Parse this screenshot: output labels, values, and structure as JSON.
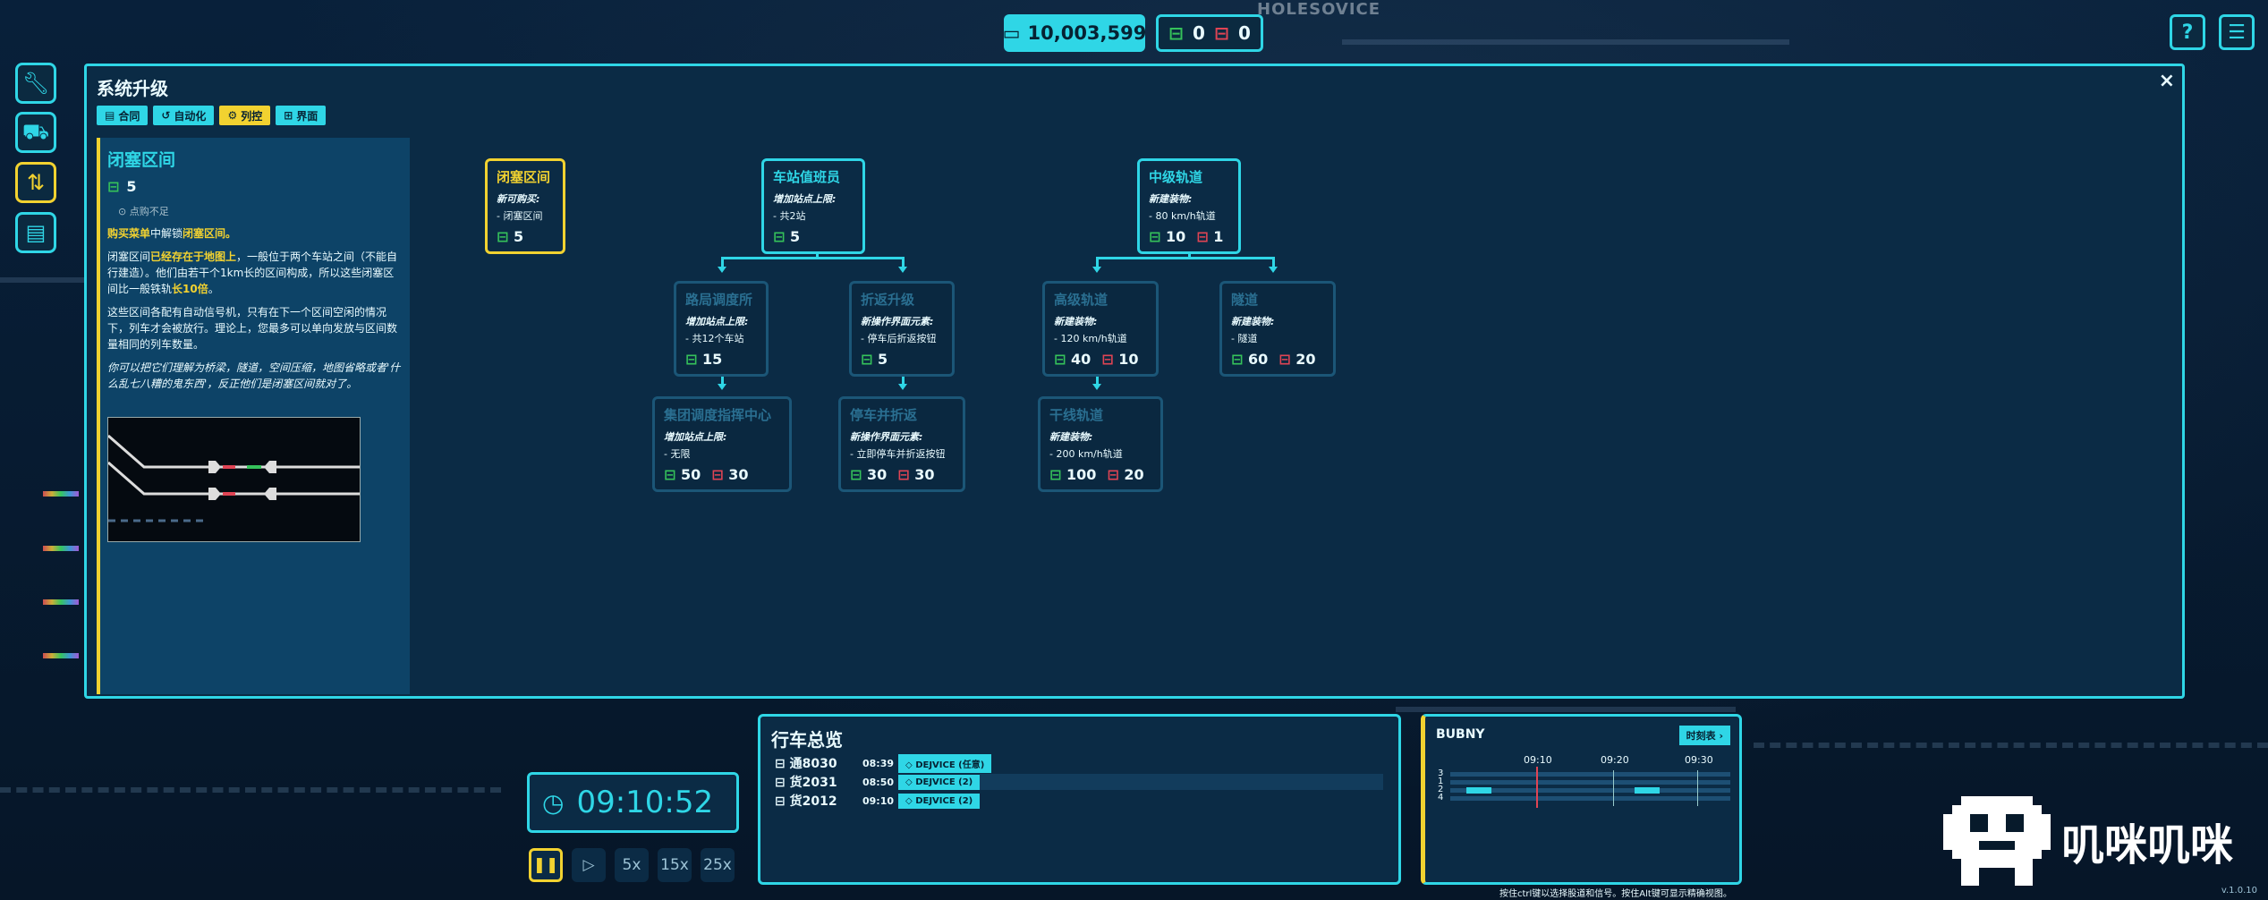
{
  "map": {
    "district_label": "HOLESOVICE"
  },
  "topbar": {
    "money": "10,003,599",
    "trains_green": "0",
    "trains_red": "0",
    "help_label": "?"
  },
  "panel": {
    "title": "系统升级",
    "close_label": "×",
    "tabs": [
      {
        "label": "合同"
      },
      {
        "label": "自动化"
      },
      {
        "label": "列控"
      },
      {
        "label": "界面"
      }
    ],
    "detail": {
      "title": "闭塞区间",
      "cost": "5",
      "status": "⊙ 点购不足",
      "p1_a": "购买菜单",
      "p1_b": "中解锁",
      "p1_c": "闭塞区间。",
      "p2_a": "闭塞区间",
      "p2_b": "已经存在于地图上",
      "p2_c": "，一般位于两个车站之间（不能自行建造）。他们由若干个1km长的区间构成，所以这些闭塞区间比一般铁轨",
      "p2_d": "长10倍",
      "p2_e": "。",
      "p3": "这些区间各配有自动信号机，只有在下一个区间空闲的情况下，列车才会被放行。理论上，您最多可以单向发放与区间数量相同的列车数量。",
      "p4": "你可以把它们理解为桥梁，隧道，空间压缩，地图省略或者'什么乱七八糟的鬼东西'，反正他们是闭塞区间就对了。"
    },
    "nodes": [
      {
        "title": "闭塞区间",
        "sub": "新可购买:",
        "line": "- 闭塞区间",
        "g": "5",
        "r": ""
      },
      {
        "title": "车站值班员",
        "sub": "增加站点上限:",
        "line": "- 共2站",
        "g": "5",
        "r": ""
      },
      {
        "title": "中级轨道",
        "sub": "新建装物:",
        "line": "- 80 km/h轨道",
        "g": "10",
        "r": "1"
      },
      {
        "title": "路局调度所",
        "sub": "增加站点上限:",
        "line": "- 共12个车站",
        "g": "15",
        "r": ""
      },
      {
        "title": "折返升级",
        "sub": "新操作界面元素:",
        "line": "- 停车后折返按钮",
        "g": "5",
        "r": ""
      },
      {
        "title": "高级轨道",
        "sub": "新建装物:",
        "line": "- 120 km/h轨道",
        "g": "40",
        "r": "10"
      },
      {
        "title": "隧道",
        "sub": "新建装物:",
        "line": "- 隧道",
        "g": "60",
        "r": "20"
      },
      {
        "title": "集团调度指挥中心",
        "sub": "增加站点上限:",
        "line": "- 无限",
        "g": "50",
        "r": "30"
      },
      {
        "title": "停车并折返",
        "sub": "新操作界面元素:",
        "line": "- 立即停车并折返按钮",
        "g": "30",
        "r": "30"
      },
      {
        "title": "干线轨道",
        "sub": "新建装物:",
        "line": "- 200 km/h轨道",
        "g": "100",
        "r": "20"
      }
    ]
  },
  "clock": {
    "time": "09:10:52"
  },
  "speeds": [
    "5x",
    "15x",
    "25x"
  ],
  "schedule": {
    "title": "行车总览",
    "rows": [
      {
        "name": "通8030",
        "time": "08:39",
        "dest": "DEJVICE (任意)"
      },
      {
        "name": "货2031",
        "time": "08:50",
        "dest": "DEJVICE (2)"
      },
      {
        "name": "货2012",
        "time": "09:10",
        "dest": "DEJVICE (2)"
      }
    ]
  },
  "station": {
    "name": "BUBNY",
    "timetable_btn": "时刻表 ›",
    "ticks": [
      "09:10",
      "09:20",
      "09:30"
    ],
    "tracks": [
      "3",
      "1",
      "2",
      "4"
    ]
  },
  "footer": {
    "hint": "按住ctrl键以选择股道和信号。按住Alt键可显示精确视图。",
    "version": "v.1.0.10"
  },
  "watermark": {
    "text": "叽咪叽咪"
  },
  "colors": {
    "accent": "#2fd6e6",
    "selected": "#f2d230",
    "green": "#35c25a",
    "red": "#e04454",
    "panel": "#0b2b45"
  }
}
